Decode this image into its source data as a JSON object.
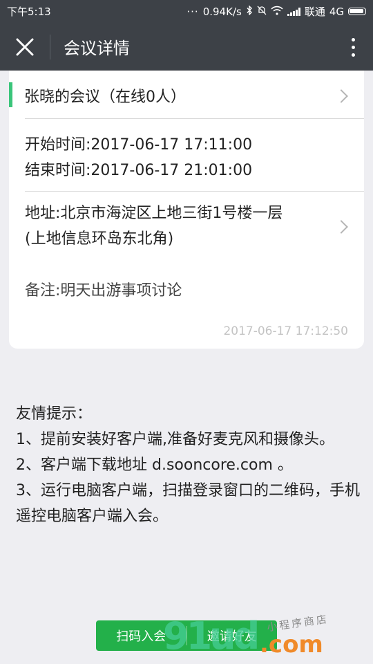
{
  "status_bar": {
    "time": "下午5:13",
    "dots": "···",
    "speed": "0.94K/s",
    "carrier": "联通",
    "network": "4G"
  },
  "nav": {
    "title": "会议详情"
  },
  "meeting": {
    "title": "张晓的会议（在线0人）",
    "start_time": "开始时间:2017-06-17 17:11:00",
    "end_time": "结束时间:2017-06-17 21:01:00",
    "address_line1": "地址:北京市海淀区上地三街1号楼一层",
    "address_line2": "(上地信息环岛东北角)",
    "note": "备注:明天出游事项讨论",
    "created_at": "2017-06-17 17:12:50"
  },
  "tips": {
    "heading": "友情提示：",
    "line1": "1、提前安装好客户端,准备好麦克风和摄像头。",
    "line2": "2、客户端下载地址 d.sooncore.com 。",
    "line3": "3、运行电脑客户端，扫描登录窗口的二维码，手机遥控电脑客户端入会。"
  },
  "buttons": {
    "scan_join": "扫码入会",
    "invite": "邀请好友"
  },
  "watermark": {
    "small_text": "小程序商店",
    "domain_text": ".com",
    "number_text": "91ud"
  },
  "colors": {
    "header_bg": "#3d4147",
    "accent": "#3ac57a",
    "button_green": "#23b04a"
  }
}
